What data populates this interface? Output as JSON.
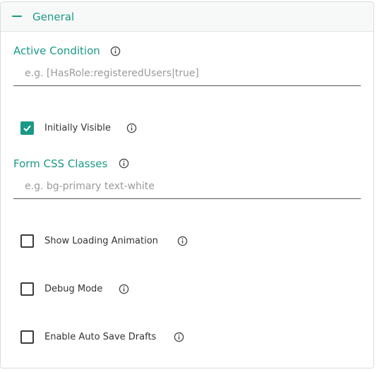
{
  "section": {
    "title": "General",
    "collapse_icon": "minus-icon"
  },
  "active_condition": {
    "label": "Active Condition",
    "placeholder": "e.g. [HasRole:registeredUsers|true]",
    "value": ""
  },
  "initially_visible": {
    "label": "Initially Visible",
    "checked": true
  },
  "form_css_classes": {
    "label": "Form CSS Classes",
    "placeholder": "e.g. bg-primary text-white",
    "value": ""
  },
  "show_loading_animation": {
    "label": "Show Loading Animation",
    "checked": false
  },
  "debug_mode": {
    "label": "Debug Mode",
    "checked": false
  },
  "enable_auto_save_drafts": {
    "label": "Enable Auto Save Drafts",
    "checked": false
  },
  "colors": {
    "accent": "#1a9988",
    "text": "#333333",
    "placeholder": "#9a9a9a"
  },
  "icons": {
    "info": "info-circle-icon",
    "check": "check-icon"
  }
}
